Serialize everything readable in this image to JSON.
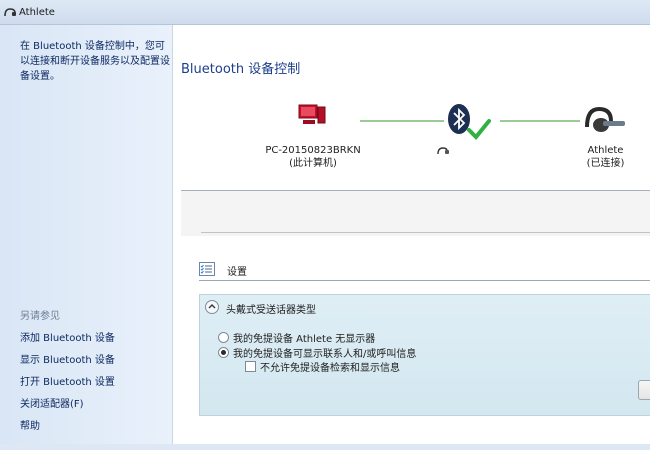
{
  "window": {
    "title": "Athlete"
  },
  "sidebar": {
    "description": "在 Bluetooth 设备控制中，您可以连接和断开设备服务以及配置设备设置。",
    "see_also": "另请参见",
    "links": [
      {
        "label": "添加 Bluetooth 设备"
      },
      {
        "label": "显示 Bluetooth 设备"
      },
      {
        "label": "打开 Bluetooth 设置"
      },
      {
        "label": "关闭适配器(F)"
      },
      {
        "label": "帮助"
      }
    ]
  },
  "main": {
    "title": "Bluetooth 设备控制",
    "computer": {
      "name": "PC-20150823BRKN",
      "status": "(此计算机)"
    },
    "headset": {
      "name": "Athlete",
      "status": "(已连接)"
    },
    "settings_label": "设置",
    "panel": {
      "header": "头戴式受送话器类型",
      "options": [
        {
          "label": "我的免提设备 Athlete 无显示器",
          "selected": false
        },
        {
          "label": "我的免提设备可显示联系人和/或呼叫信息",
          "selected": true
        }
      ],
      "checkbox": {
        "label": "不允许免提设备检索和显示信息",
        "checked": false
      }
    }
  },
  "colors": {
    "accent": "#1d3e8c",
    "link": "#0e2a63",
    "connection_line": "#9ccc95"
  },
  "icons": [
    "athlete-headset-icon",
    "computer-icon",
    "bluetooth-icon",
    "check-icon",
    "headset-icon",
    "small-headset-icon",
    "settings-list-icon",
    "chevron-up-icon"
  ]
}
